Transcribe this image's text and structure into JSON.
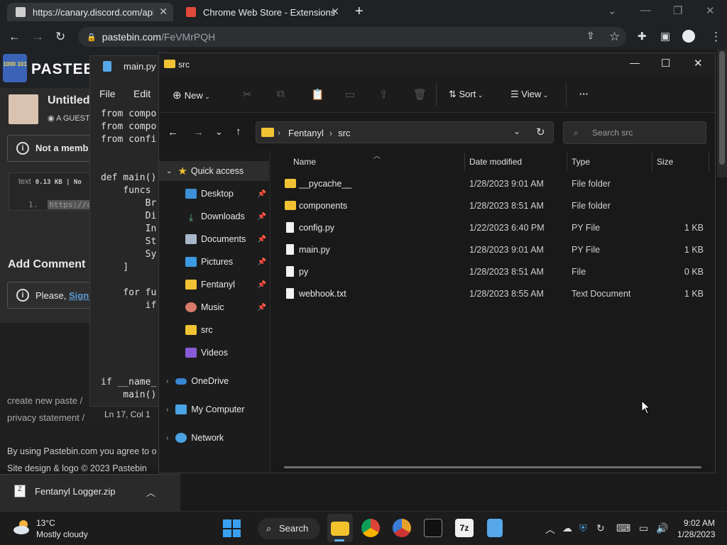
{
  "browser": {
    "tabs": [
      {
        "label": "https://canary.discord.com/api/w"
      },
      {
        "label": "Chrome Web Store - Extensions"
      }
    ],
    "new_tab": "+",
    "url_host": "pastebin.com",
    "url_path": "/FeVMrPQH"
  },
  "pastebin": {
    "logo_text": "PASTEB",
    "logo_badge": "1000 101",
    "paste_title": "Untitled",
    "author": "A GUEST",
    "not_member": "Not a memb",
    "code_meta_lang": "text",
    "code_meta_size": "0.13 KB | No",
    "line_no": "1.",
    "line_text": "https://c",
    "add_comment": "Add Comment",
    "please_text": "Please, ",
    "sign_link": "Sign I",
    "footer": [
      "create new paste  /",
      "privacy statement  /",
      "By using Pastebin.com you agree to o",
      "Site design & logo © 2023 Pastebin"
    ]
  },
  "notepad": {
    "title": "main.py -",
    "menu": [
      "File",
      "Edit"
    ],
    "code": "from compo\nfrom compo\nfrom confi\n\n\ndef main()\n    funcs\n        Br\n        Di\n        In\n        St\n        Sy\n    ]\n\n    for fu\n        if\n\n\n\n\n\nif __name_\n    main()",
    "status": "Ln 17, Col 1"
  },
  "download": {
    "file": "Fentanyl Logger.zip"
  },
  "explorer": {
    "title": "src",
    "toolbar": {
      "new": "New",
      "sort": "Sort",
      "view": "View",
      "more": "···"
    },
    "breadcrumb": [
      "Fentanyl",
      "src"
    ],
    "search_placeholder": "Search src",
    "nav": [
      {
        "label": "Quick access",
        "icon": "star-icon",
        "pinned": false
      },
      {
        "label": "Desktop",
        "icon": "desktop-icon",
        "pinned": true
      },
      {
        "label": "Downloads",
        "icon": "download-icon",
        "pinned": true
      },
      {
        "label": "Documents",
        "icon": "documents-icon",
        "pinned": true
      },
      {
        "label": "Pictures",
        "icon": "pictures-icon",
        "pinned": true
      },
      {
        "label": "Fentanyl",
        "icon": "folder-icon",
        "pinned": true
      },
      {
        "label": "Music",
        "icon": "music-icon",
        "pinned": true
      },
      {
        "label": "src",
        "icon": "folder-icon",
        "pinned": false
      },
      {
        "label": "Videos",
        "icon": "videos-icon",
        "pinned": false
      },
      {
        "label": "OneDrive",
        "icon": "cloud-icon",
        "pinned": false
      },
      {
        "label": "My Computer",
        "icon": "computer-icon",
        "pinned": false
      },
      {
        "label": "Network",
        "icon": "network-icon",
        "pinned": false
      }
    ],
    "columns": [
      "Name",
      "Date modified",
      "Type",
      "Size"
    ],
    "files": [
      {
        "name": "__pycache__",
        "date": "1/28/2023 9:01 AM",
        "type": "File folder",
        "size": "",
        "kind": "folder"
      },
      {
        "name": "components",
        "date": "1/28/2023 8:51 AM",
        "type": "File folder",
        "size": "",
        "kind": "folder"
      },
      {
        "name": "config.py",
        "date": "1/22/2023 6:40 PM",
        "type": "PY File",
        "size": "1 KB",
        "kind": "file"
      },
      {
        "name": "main.py",
        "date": "1/28/2023 9:01 AM",
        "type": "PY File",
        "size": "1 KB",
        "kind": "file"
      },
      {
        "name": "py",
        "date": "1/28/2023 8:51 AM",
        "type": "File",
        "size": "0 KB",
        "kind": "file"
      },
      {
        "name": "webhook.txt",
        "date": "1/28/2023 8:55 AM",
        "type": "Text Document",
        "size": "1 KB",
        "kind": "file"
      }
    ]
  },
  "taskbar": {
    "temp": "13°C",
    "condition": "Mostly cloudy",
    "search": "Search",
    "time": "9:02 AM",
    "date": "1/28/2023"
  }
}
